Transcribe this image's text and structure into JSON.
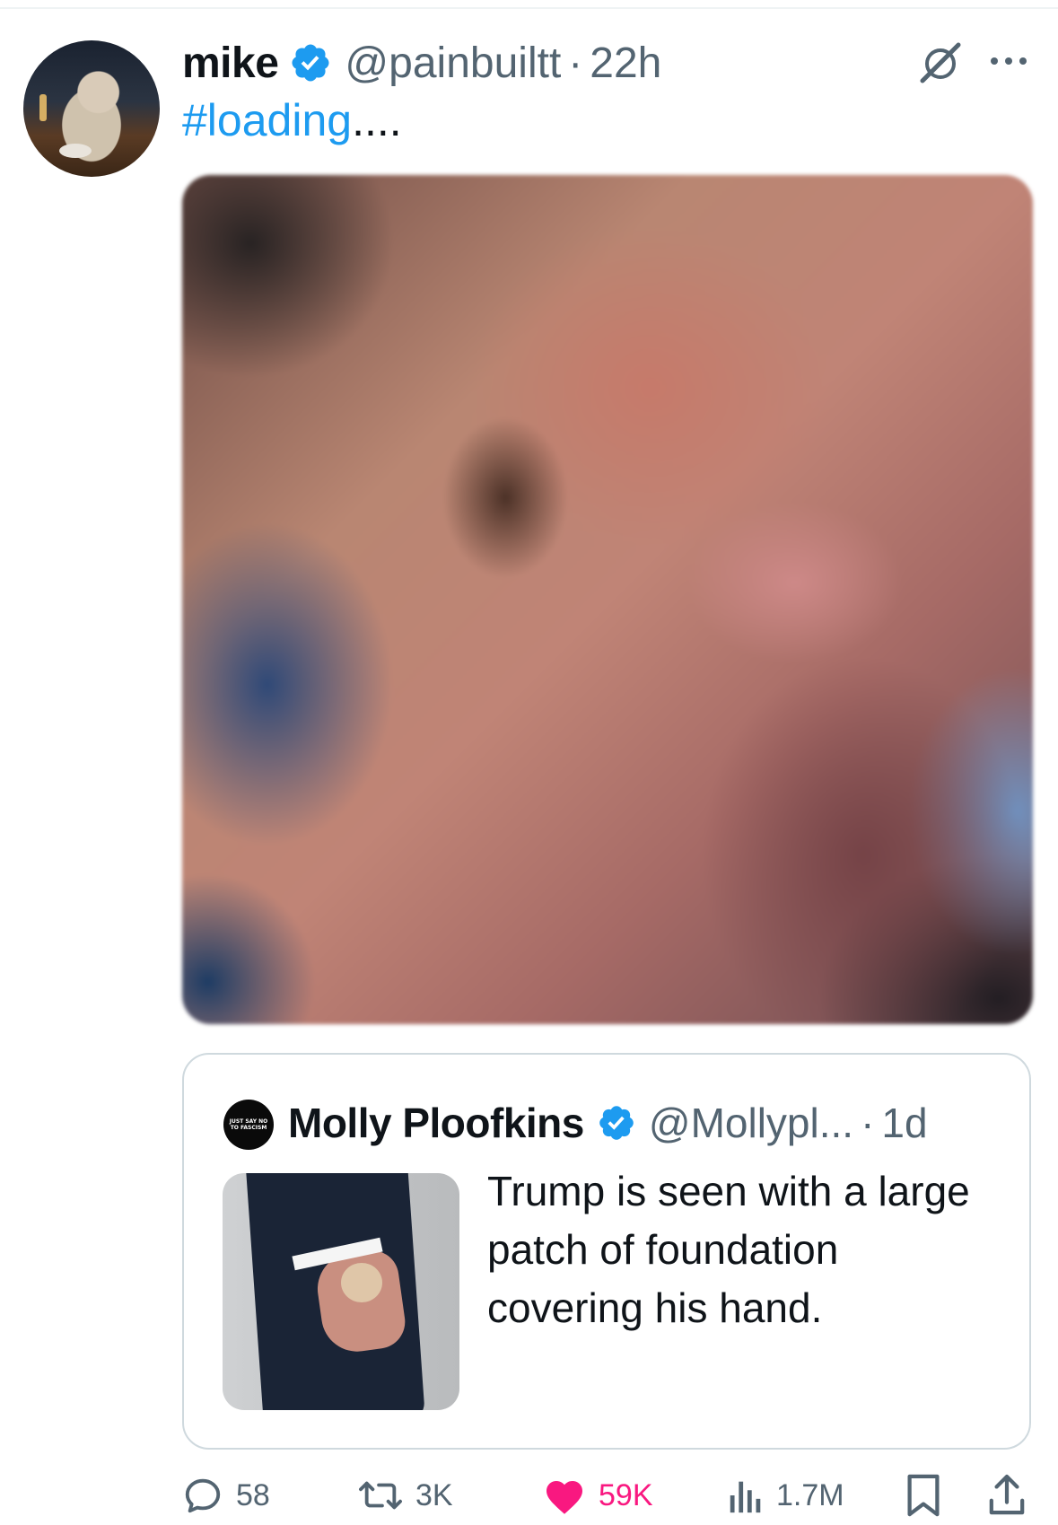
{
  "tweet": {
    "author": {
      "display_name": "mike",
      "handle": "@painbuiltt",
      "verified": true
    },
    "separator": "·",
    "time": "22h",
    "text": {
      "hashtag": "#loading",
      "rest": "...."
    },
    "media": {
      "state": "blurred",
      "colors": [
        "#c08476",
        "#6e4c45",
        "#2b4c78"
      ]
    }
  },
  "quoted_tweet": {
    "author": {
      "display_name": "Molly Ploofkins",
      "handle": "@Mollypl...",
      "verified": true,
      "avatar_text": [
        "JUST SAY NO",
        "TO FASCISM"
      ]
    },
    "separator": "·",
    "time": "1d",
    "text": "Trump is seen with a large patch of foundation covering his hand."
  },
  "actions": {
    "replies": "58",
    "retweets": "3K",
    "likes": "59K",
    "views": "1.7M"
  },
  "colors": {
    "link": "#1d9bf0",
    "verified": "#1d9bf0",
    "secondary_text": "#536471",
    "like": "#f91880",
    "border": "#cfd9de"
  },
  "icons": [
    "verified-badge-icon",
    "grok-icon",
    "more-icon",
    "reply-icon",
    "retweet-icon",
    "heart-icon",
    "views-icon",
    "bookmark-icon",
    "share-icon"
  ]
}
